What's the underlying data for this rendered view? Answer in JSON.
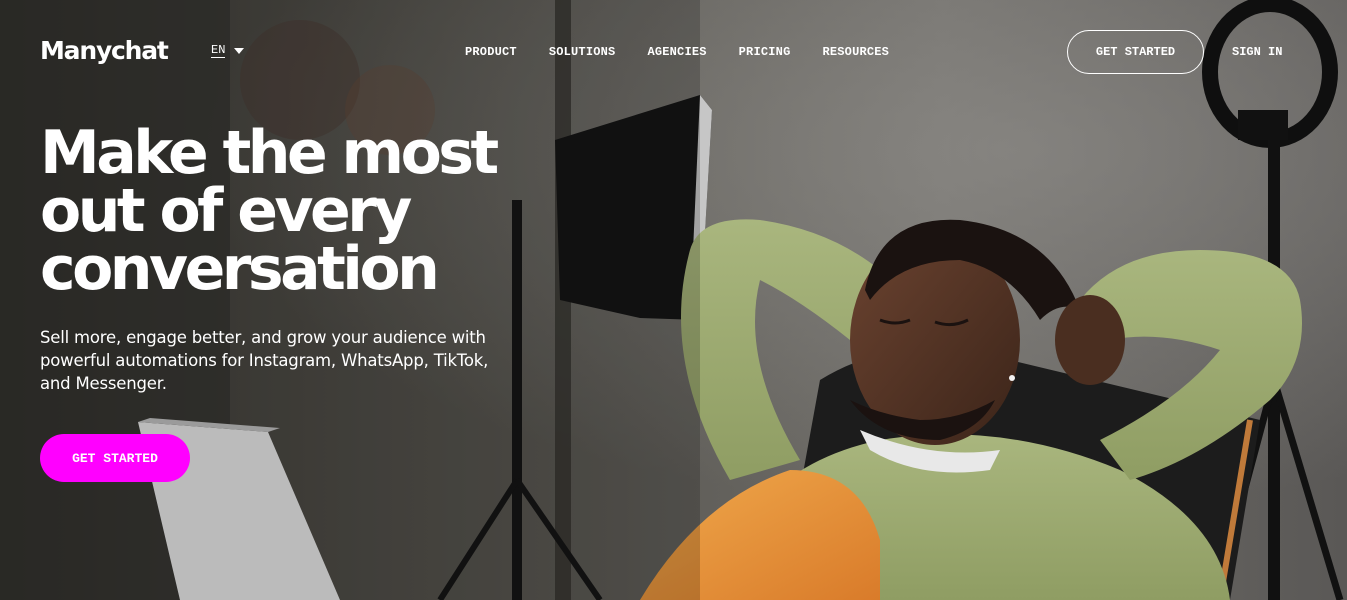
{
  "header": {
    "logo_text": "Manychat",
    "language": "EN",
    "nav": [
      {
        "label": "PRODUCT"
      },
      {
        "label": "SOLUTIONS"
      },
      {
        "label": "AGENCIES"
      },
      {
        "label": "PRICING"
      },
      {
        "label": "RESOURCES"
      }
    ],
    "get_started_label": "GET STARTED",
    "sign_in_label": "SIGN IN"
  },
  "hero": {
    "headline_lines": [
      "Make the most",
      "out of every",
      "conversation"
    ],
    "subtitle": "Sell more, engage better, and grow your audience with powerful automations for Instagram, WhatsApp, TikTok, and Messenger.",
    "cta_label": "GET STARTED"
  },
  "colors": {
    "accent": "#ff00ff",
    "text": "#ffffff"
  }
}
